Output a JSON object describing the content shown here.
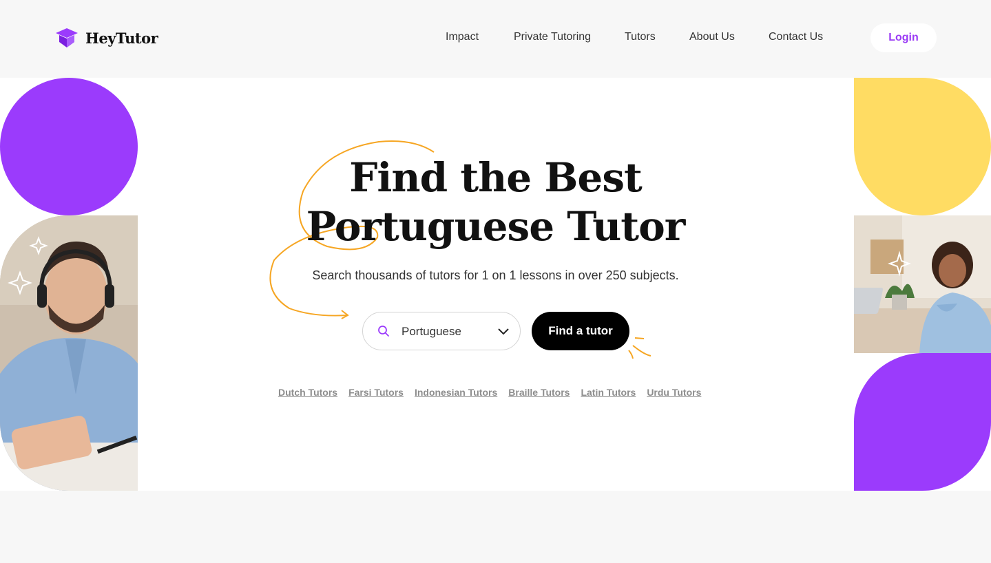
{
  "brand": {
    "name": "HeyTutor",
    "accent": "#9b3bfc",
    "yellow": "#ffdc63"
  },
  "nav": {
    "items": [
      {
        "label": "Impact"
      },
      {
        "label": "Private Tutoring"
      },
      {
        "label": "Tutors"
      },
      {
        "label": "About Us"
      },
      {
        "label": "Contact Us"
      }
    ],
    "login_label": "Login"
  },
  "hero": {
    "title_line1": "Find the Best",
    "title_line2": "Portuguese Tutor",
    "subtitle": "Search thousands of tutors for 1 on 1 lessons in over 250 subjects.",
    "search": {
      "value": "Portuguese",
      "icon": "search-icon",
      "dropdown_icon": "chevron-down-icon"
    },
    "cta_label": "Find a tutor",
    "quick_links": [
      {
        "label": "Dutch Tutors"
      },
      {
        "label": "Farsi Tutors"
      },
      {
        "label": "Indonesian Tutors"
      },
      {
        "label": "Braille Tutors"
      },
      {
        "label": "Latin Tutors"
      },
      {
        "label": "Urdu Tutors"
      }
    ]
  }
}
